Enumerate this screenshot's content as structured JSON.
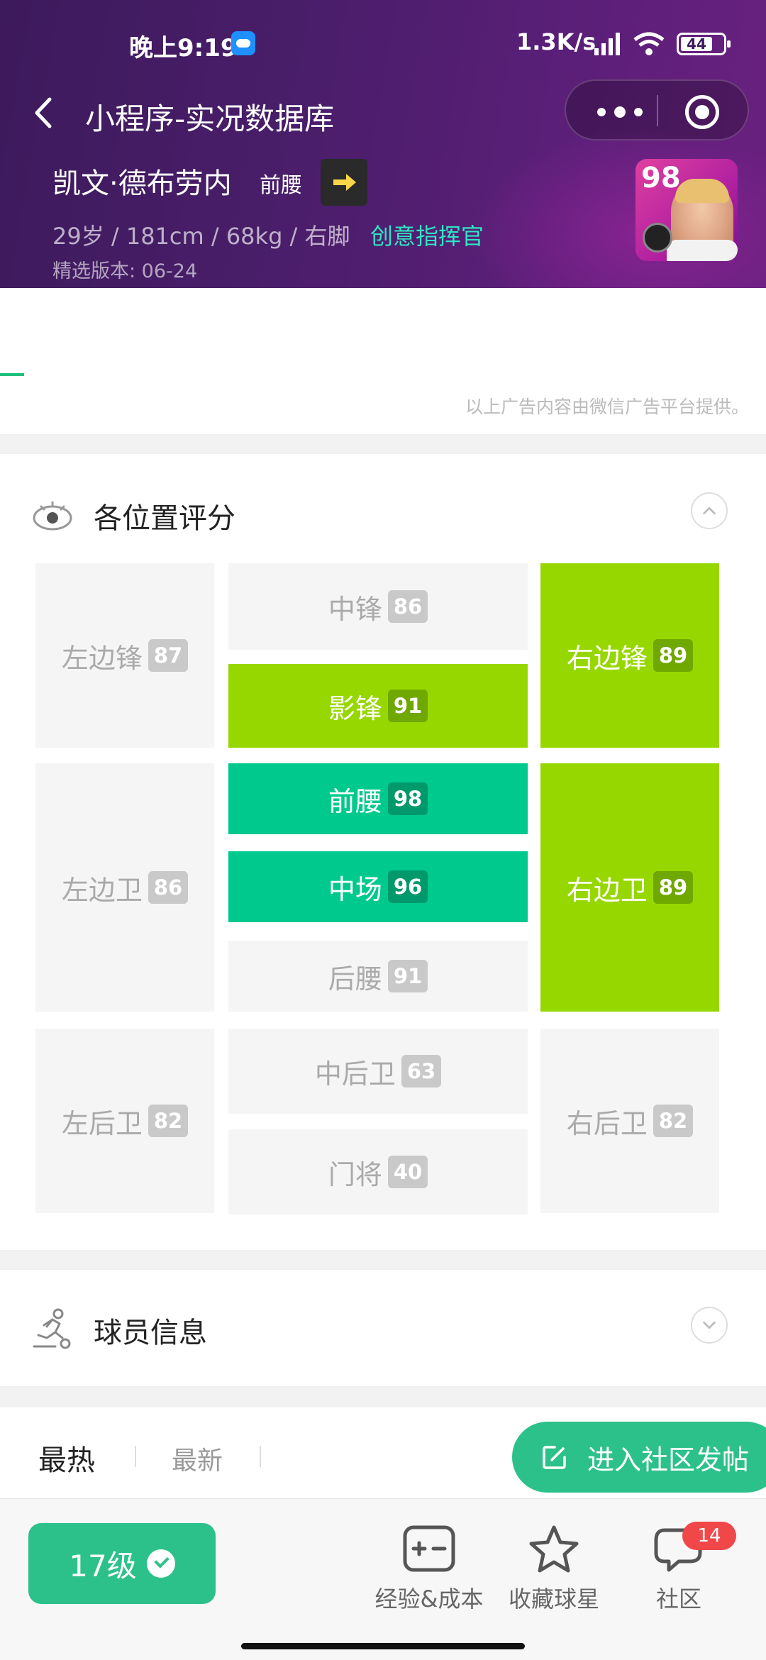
{
  "status_bar": {
    "time": "晚上9:19",
    "network_speed": "1.3K/s",
    "battery": "44"
  },
  "nav": {
    "title": "小程序-实况数据库"
  },
  "player": {
    "name": "凯文·德布劳内",
    "position": "前腰",
    "stats": "29岁 / 181cm / 68kg / 右脚",
    "play_style": "创意指挥官",
    "version": "精选版本: 06-24",
    "overall": "98"
  },
  "ad": {
    "note": "以上广告内容由微信广告平台提供。"
  },
  "positions_section": {
    "title": "各位置评分",
    "cells": {
      "lwf": {
        "label": "左边锋",
        "score": "87"
      },
      "cf": {
        "label": "中锋",
        "score": "86"
      },
      "ss": {
        "label": "影锋",
        "score": "91"
      },
      "rwf": {
        "label": "右边锋",
        "score": "89"
      },
      "lmf": {
        "label": "左边卫",
        "score": "86"
      },
      "amf": {
        "label": "前腰",
        "score": "98"
      },
      "cmf": {
        "label": "中场",
        "score": "96"
      },
      "dmf": {
        "label": "后腰",
        "score": "91"
      },
      "rmf": {
        "label": "右边卫",
        "score": "89"
      },
      "lb": {
        "label": "左后卫",
        "score": "82"
      },
      "cb": {
        "label": "中后卫",
        "score": "63"
      },
      "gk": {
        "label": "门将",
        "score": "40"
      },
      "rb": {
        "label": "右后卫",
        "score": "82"
      }
    },
    "colors": {
      "lime": "#97d700",
      "teal": "#00c98d",
      "neutral": "#f5f5f5"
    }
  },
  "info_section": {
    "title": "球员信息"
  },
  "comments": {
    "tab_hot": "最热",
    "tab_new": "最新",
    "community_button": "进入社区发帖"
  },
  "bottom_bar": {
    "level_label": "17级",
    "tools": [
      {
        "label": "经验&成本",
        "icon": "calculator-icon"
      },
      {
        "label": "收藏球星",
        "icon": "star-icon"
      },
      {
        "label": "社区",
        "icon": "chat-icon",
        "badge": "14"
      }
    ]
  },
  "accent_color": "#2cc18b"
}
